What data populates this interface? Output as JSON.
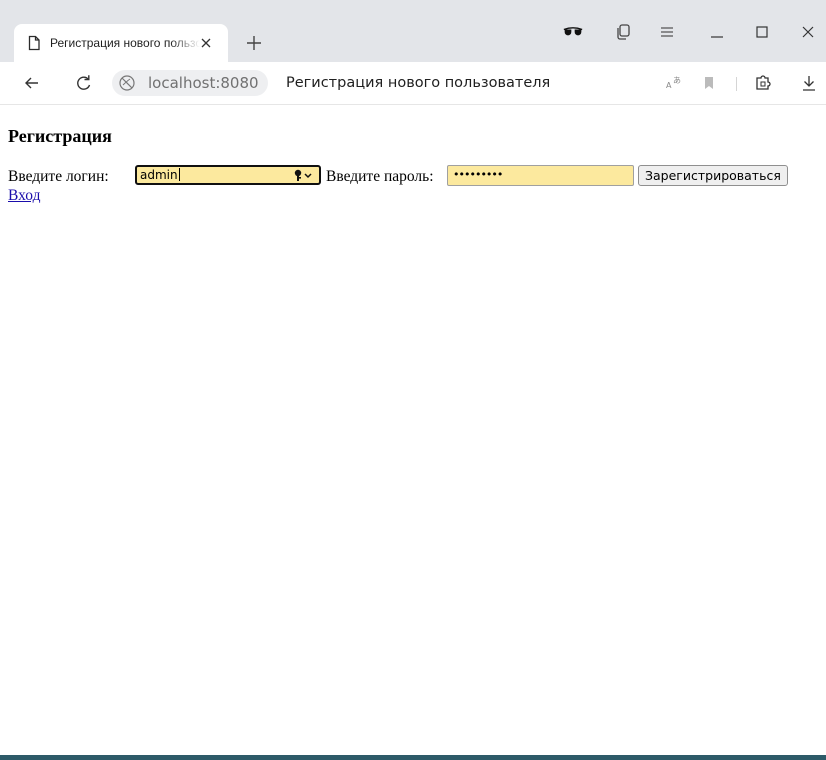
{
  "browser": {
    "tab": {
      "title": "Регистрация нового пользователя"
    },
    "address_bar": {
      "host": "localhost:8080",
      "page_title": "Регистрация нового пользователя"
    },
    "icons": {
      "page": "document-icon",
      "close": "close-icon",
      "new_tab": "plus-icon",
      "incognito": "sunglasses-icon",
      "tab_manager": "tabs-icon",
      "menu": "hamburger-menu-icon",
      "minimize": "minimize-icon",
      "maximize": "maximize-icon",
      "close_window": "close-window-icon",
      "back": "arrow-left-icon",
      "reload": "reload-icon",
      "site_info": "globe-icon",
      "translate": "translate-icon",
      "bookmark": "bookmark-icon",
      "extensions": "extension-icon",
      "downloads": "download-icon"
    }
  },
  "page": {
    "heading": "Регистрация",
    "form": {
      "login_label": "Введите логин:",
      "login_value": "admin",
      "password_label": "Введите пароль:",
      "password_value": "•••••••••",
      "submit_label": "Зарегистрироваться"
    },
    "login_link": "Вход"
  },
  "colors": {
    "autofill_background": "#fce99e",
    "link": "#1a0dab",
    "tabstrip": "#e3e5e9",
    "bottom_bar": "#2d5a68"
  }
}
